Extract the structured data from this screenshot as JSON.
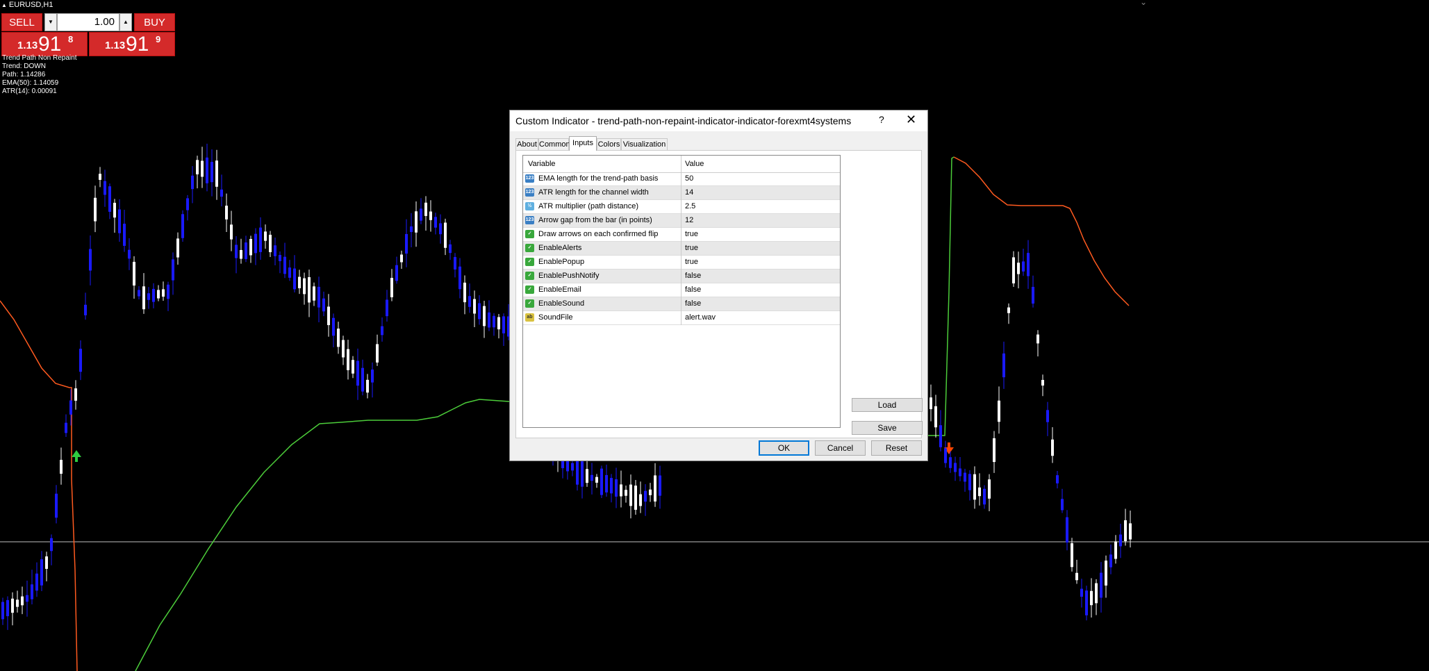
{
  "symbol": "EURUSD,H1",
  "trade_panel": {
    "sell_label": "SELL",
    "buy_label": "BUY",
    "lot": "1.00",
    "sell_price": {
      "big": "1.13",
      "main": "91",
      "sup": "8"
    },
    "buy_price": {
      "big": "1.13",
      "main": "91",
      "sup": "9"
    }
  },
  "indicator_info": {
    "name": "Trend Path Non Repaint",
    "trend": "Trend: DOWN",
    "path": "Path: 1.14286",
    "ema": "EMA(50): 1.14059",
    "atr": "ATR(14): 0.00091"
  },
  "colors": {
    "bull_candle": "#ffffff",
    "bear_candle": "#1a1aff",
    "up_path": "#4ccd3a",
    "down_path": "#ff5a1f",
    "up_arrow": "#2ecc40",
    "down_arrow": "#ff4500",
    "crosshair": "#c0c0c0"
  },
  "dialog": {
    "title": "Custom Indicator - trend-path-non-repaint-indicator-indicator-forexmt4systems",
    "help": "?",
    "close": "✕",
    "tabs": [
      "About",
      "Common",
      "Inputs",
      "Colors",
      "Visualization"
    ],
    "active_tab": "Inputs",
    "columns": {
      "variable": "Variable",
      "value": "Value"
    },
    "rows": [
      {
        "icon": "123",
        "type": "num",
        "variable": "EMA length for the trend-path basis",
        "value": "50"
      },
      {
        "icon": "123",
        "type": "num",
        "variable": "ATR length for the channel width",
        "value": "14"
      },
      {
        "icon": "½",
        "type": "frac",
        "variable": "ATR multiplier (path distance)",
        "value": "2.5"
      },
      {
        "icon": "123",
        "type": "num",
        "variable": "Arrow gap from the bar (in points)",
        "value": "12"
      },
      {
        "icon": "✓",
        "type": "bool",
        "variable": "Draw arrows on each confirmed flip",
        "value": "true"
      },
      {
        "icon": "✓",
        "type": "bool",
        "variable": "EnableAlerts",
        "value": "true"
      },
      {
        "icon": "✓",
        "type": "bool",
        "variable": "EnablePopup",
        "value": "true"
      },
      {
        "icon": "✓",
        "type": "bool",
        "variable": "EnablePushNotify",
        "value": "false"
      },
      {
        "icon": "✓",
        "type": "bool",
        "variable": "EnableEmail",
        "value": "false"
      },
      {
        "icon": "✓",
        "type": "bool",
        "variable": "EnableSound",
        "value": "false"
      },
      {
        "icon": "ab",
        "type": "str",
        "variable": "SoundFile",
        "value": "alert.wav"
      }
    ],
    "buttons": {
      "load": "Load",
      "save": "Save",
      "ok": "OK",
      "cancel": "Cancel",
      "reset": "Reset"
    }
  }
}
